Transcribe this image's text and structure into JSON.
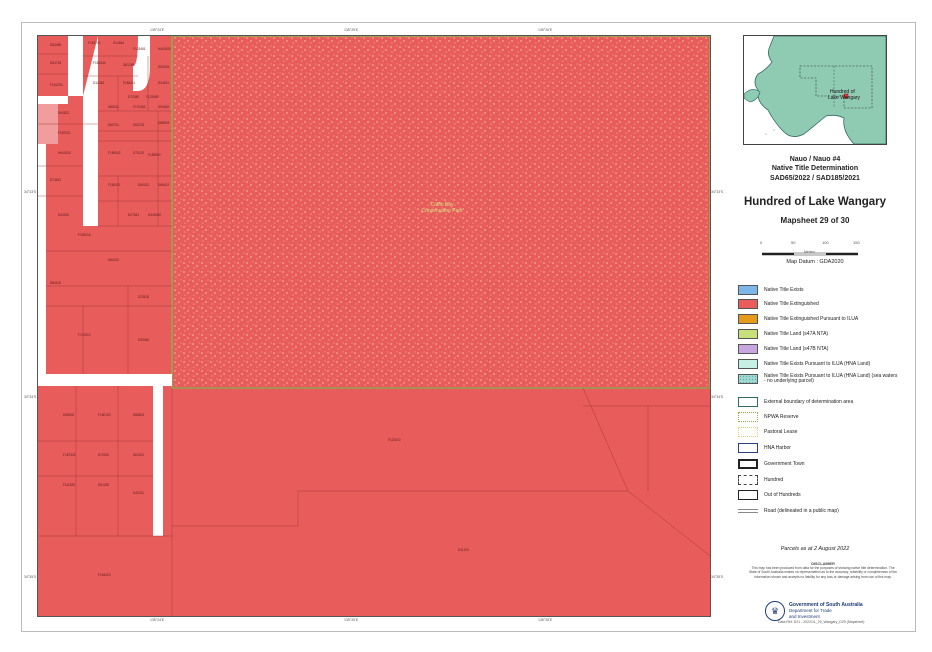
{
  "title": {
    "line1": "Nauo / Nauo #4",
    "line2": "Native Title Determination",
    "line3": "SAD65/2022 / SAD185/2021",
    "main": "Hundred of Lake Wangary",
    "mapsheet": "Mapsheet 29 of 30"
  },
  "scale": {
    "ticks": [
      "0",
      "50",
      "100",
      "150"
    ],
    "unit": "Metres",
    "datum": "Map Datum : GDA2020"
  },
  "inset": {
    "label_line1": "Hundred of",
    "label_line2": "Lake Wangary"
  },
  "legend": [
    {
      "name": "legend-native-title-exists",
      "label": "Native Title Exists",
      "color": "#7eb6ea"
    },
    {
      "name": "legend-native-title-extinguished",
      "label": "Native Title Extinguished",
      "color": "#e85c5c"
    },
    {
      "name": "legend-extinguished-ilua",
      "label": "Native Title Extinguished Pursuant to ILUA",
      "color": "#e69a1c"
    },
    {
      "name": "legend-s47a",
      "label": "Native Title Land (s47A NTA)",
      "color": "#c8e07a"
    },
    {
      "name": "legend-s47b",
      "label": "Native Title Land (s47B NTA)",
      "color": "#c9a6df"
    },
    {
      "name": "legend-exists-ilua-hna",
      "label": "Native Title Exists Pursuant to ILUA (HNA Land)",
      "color": "#c6f0e4"
    },
    {
      "name": "legend-exists-ilua-sea",
      "label": "Native Title Exists Pursuant to ILUA (HNA Land) (sea waters - no underlying parcel)",
      "color": "#9ed8d0"
    },
    {
      "name": "legend-external-boundary",
      "label": "External boundary of determination area",
      "color": "#2e6b63"
    },
    {
      "name": "legend-npwa-reserve",
      "label": "NPWA Reserve",
      "color": "#8ab04a"
    },
    {
      "name": "legend-pastoral-lease",
      "label": "Pastoral Lease",
      "color": "#e0d07a"
    },
    {
      "name": "legend-hna-harbor",
      "label": "HNA Harbor",
      "color": "#2a3f8a"
    },
    {
      "name": "legend-government-town",
      "label": "Government Town",
      "color": "#222222"
    },
    {
      "name": "legend-hundred",
      "label": "Hundred",
      "color": "#444444"
    },
    {
      "name": "legend-out-of-hundreds",
      "label": "Out of Hundreds",
      "color": "#222222"
    },
    {
      "name": "legend-road",
      "label": "Road (delineated in a public map)",
      "color": "#888888"
    }
  ],
  "parcels_date": "Parcels as at 2 August 2022",
  "disclaimer": {
    "heading": "DISCLAIMER",
    "text": "This map has been produced from data for the purposes of showing native title determination. The State of South Australia makes no representation as to the accuracy, reliability or completeness of the information shown and accepts no liability for any loss or damage arising from use of this map."
  },
  "government": {
    "name": "Government of South Australia",
    "dept1": "Department for Trade",
    "dept2": "and Investment"
  },
  "map": {
    "reserve_label_line1": "Coffin Bay",
    "reserve_label_line2": "Conservation Park",
    "top_ticks": [
      "135°24'E",
      "135°25'E",
      "135°26'E"
    ],
    "bottom_ticks": [
      "135°24'E",
      "135°25'E",
      "135°26'E"
    ],
    "left_ticks": [
      "34°33'S",
      "34°34'S",
      "34°35'S"
    ],
    "right_ticks": [
      "34°33'S",
      "34°34'S",
      "34°35'S"
    ],
    "parcel_labels": [
      "D83456",
      "F183742",
      "D12844",
      "F123451",
      "H440100",
      "D54733",
      "F182444",
      "D81245",
      "D92015",
      "F161293",
      "D12345",
      "F184311",
      "D44521",
      "D70340",
      "F123489",
      "D40821",
      "D85211",
      "F170452",
      "D93402",
      "F187001",
      "D60711",
      "D52133",
      "D88903",
      "H440120",
      "F150042",
      "D70115",
      "F183900",
      "D74521",
      "F181021",
      "D50021",
      "D66412",
      "D40032",
      "D27641",
      "H440050",
      "F190016",
      "D60210",
      "D84120",
      "D23100",
      "F170012",
      "D30452",
      "D98002",
      "F160123",
      "D58813",
      "F187322",
      "D70032",
      "D61100",
      "F111520",
      "D91230",
      "D40211",
      "F122010",
      "D11220",
      "F164410"
    ],
    "ref_text": "Data Ref: D21 - 2022/11_29_Wangary_D29 (Mapsheet)"
  }
}
